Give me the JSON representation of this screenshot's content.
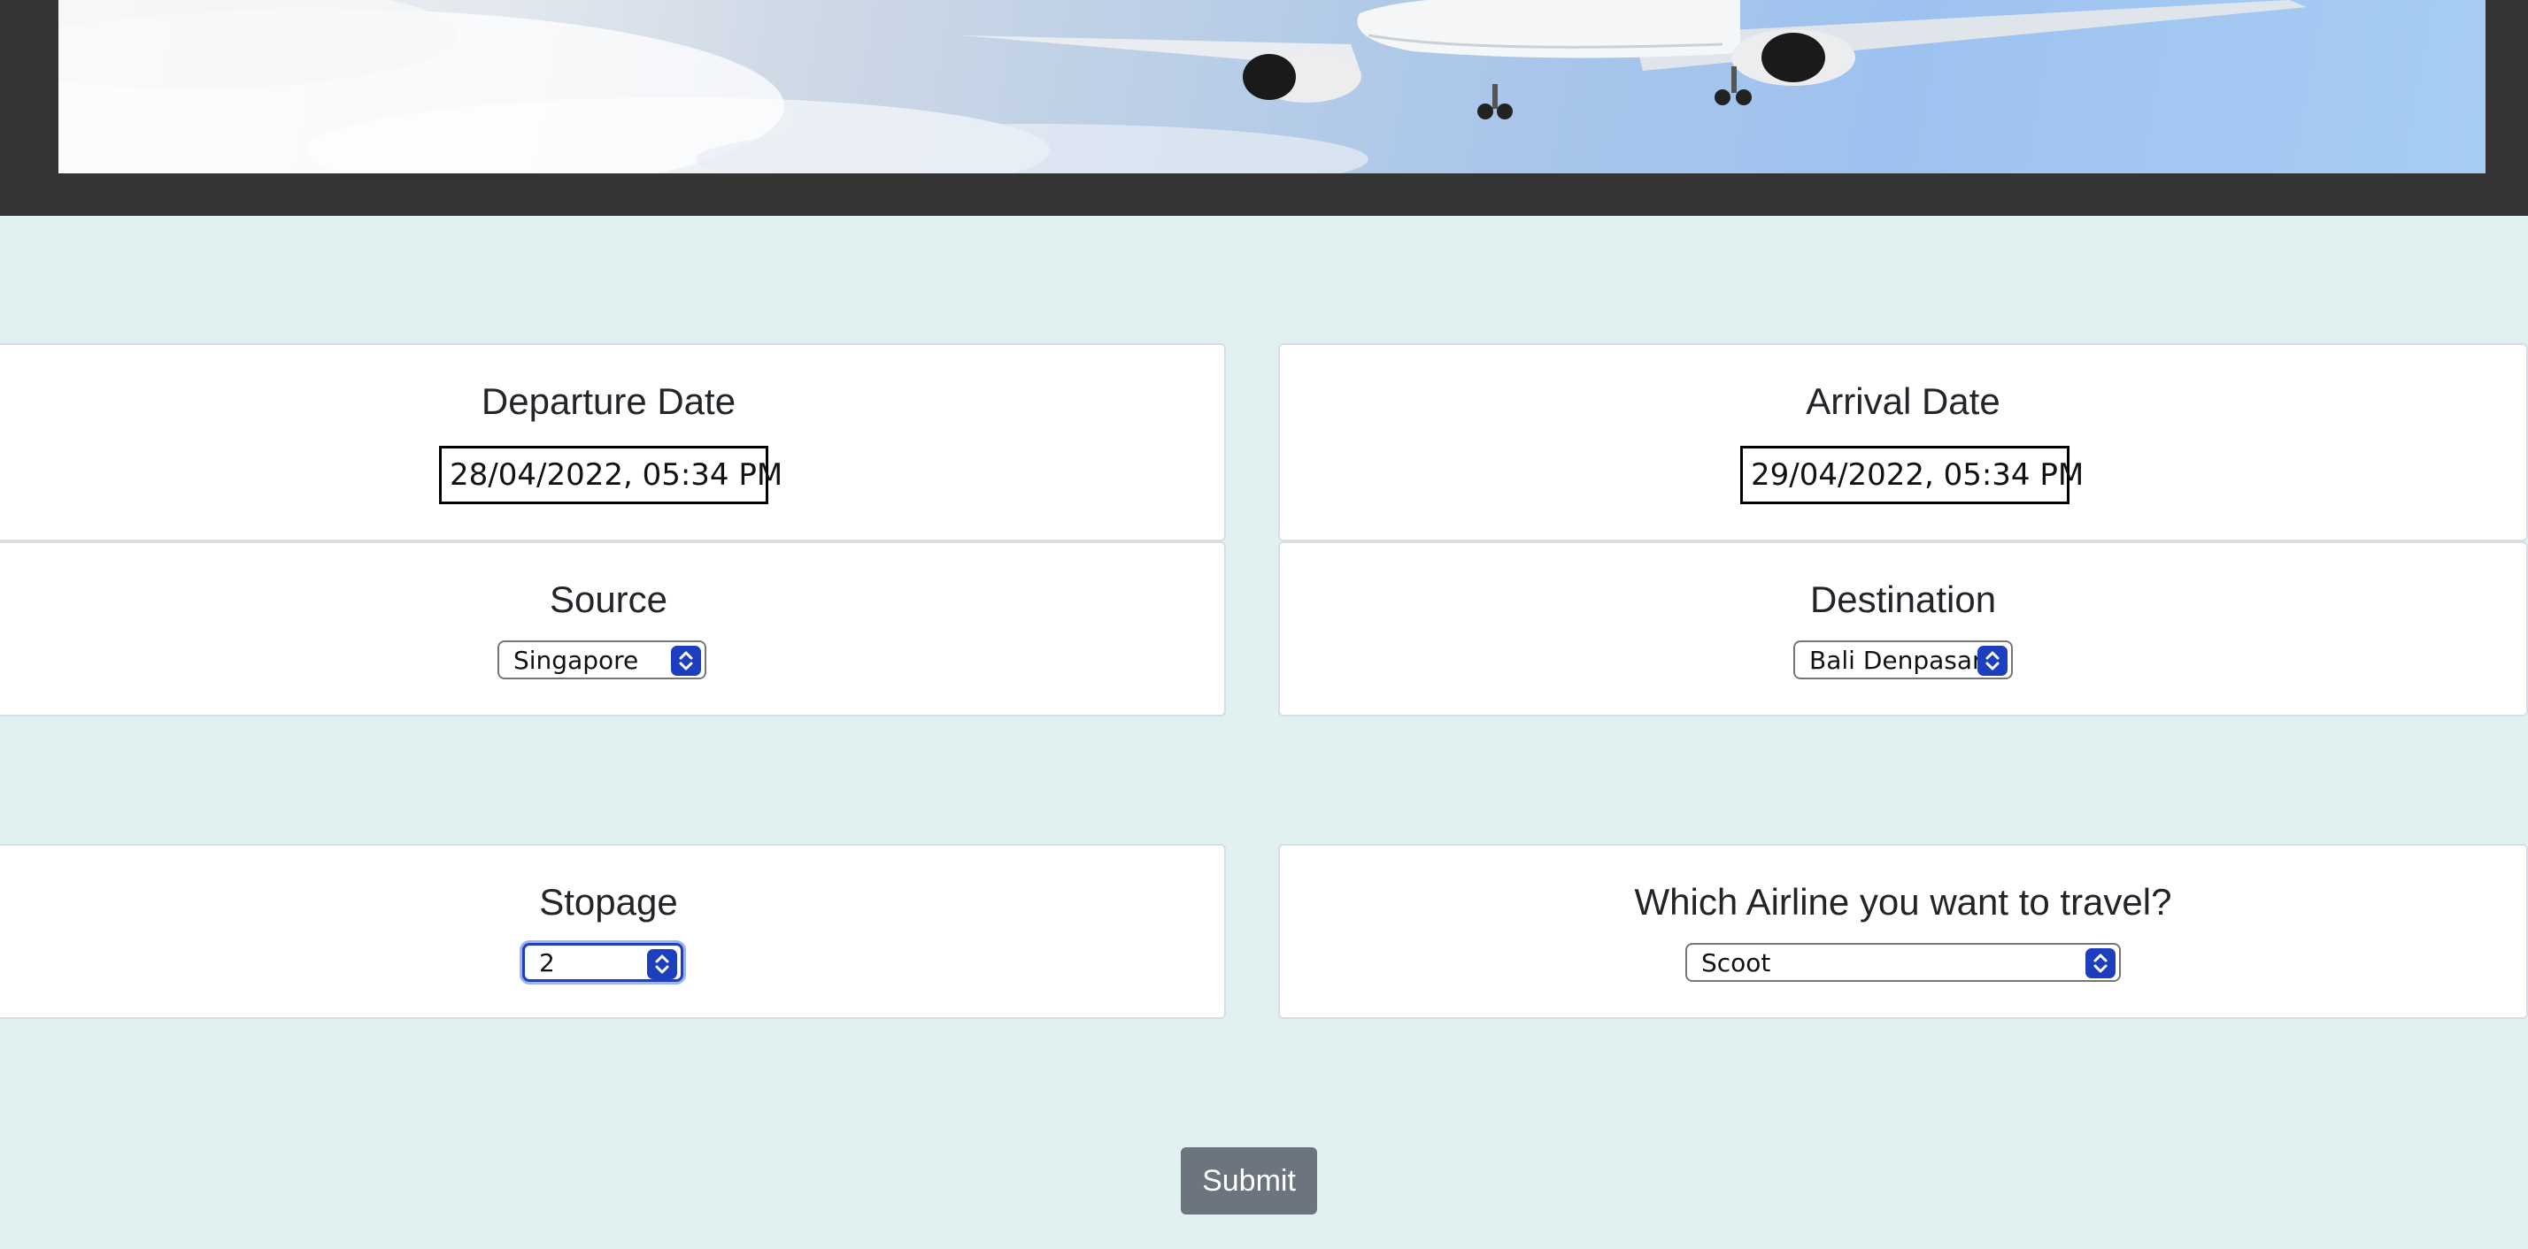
{
  "form": {
    "departure": {
      "title": "Departure Date",
      "value": "28/04/2022, 05:34 PM"
    },
    "arrival": {
      "title": "Arrival Date",
      "value": "29/04/2022, 05:34 PM"
    },
    "source": {
      "title": "Source",
      "selected": "Singapore"
    },
    "destination": {
      "title": "Destination",
      "selected": "Bali Denpasar"
    },
    "stopage": {
      "title": "Stopage",
      "selected": "2"
    },
    "airline": {
      "title": "Which Airline you want to travel?",
      "selected": "Scoot"
    },
    "submit_label": "Submit"
  },
  "icons": {
    "select_arrow": "chevron-up-down-icon"
  },
  "colors": {
    "page_background": "#e1f1f1",
    "header_background": "#343434",
    "submit_button": "#6c757d",
    "select_accent": "#1d3fbf"
  }
}
